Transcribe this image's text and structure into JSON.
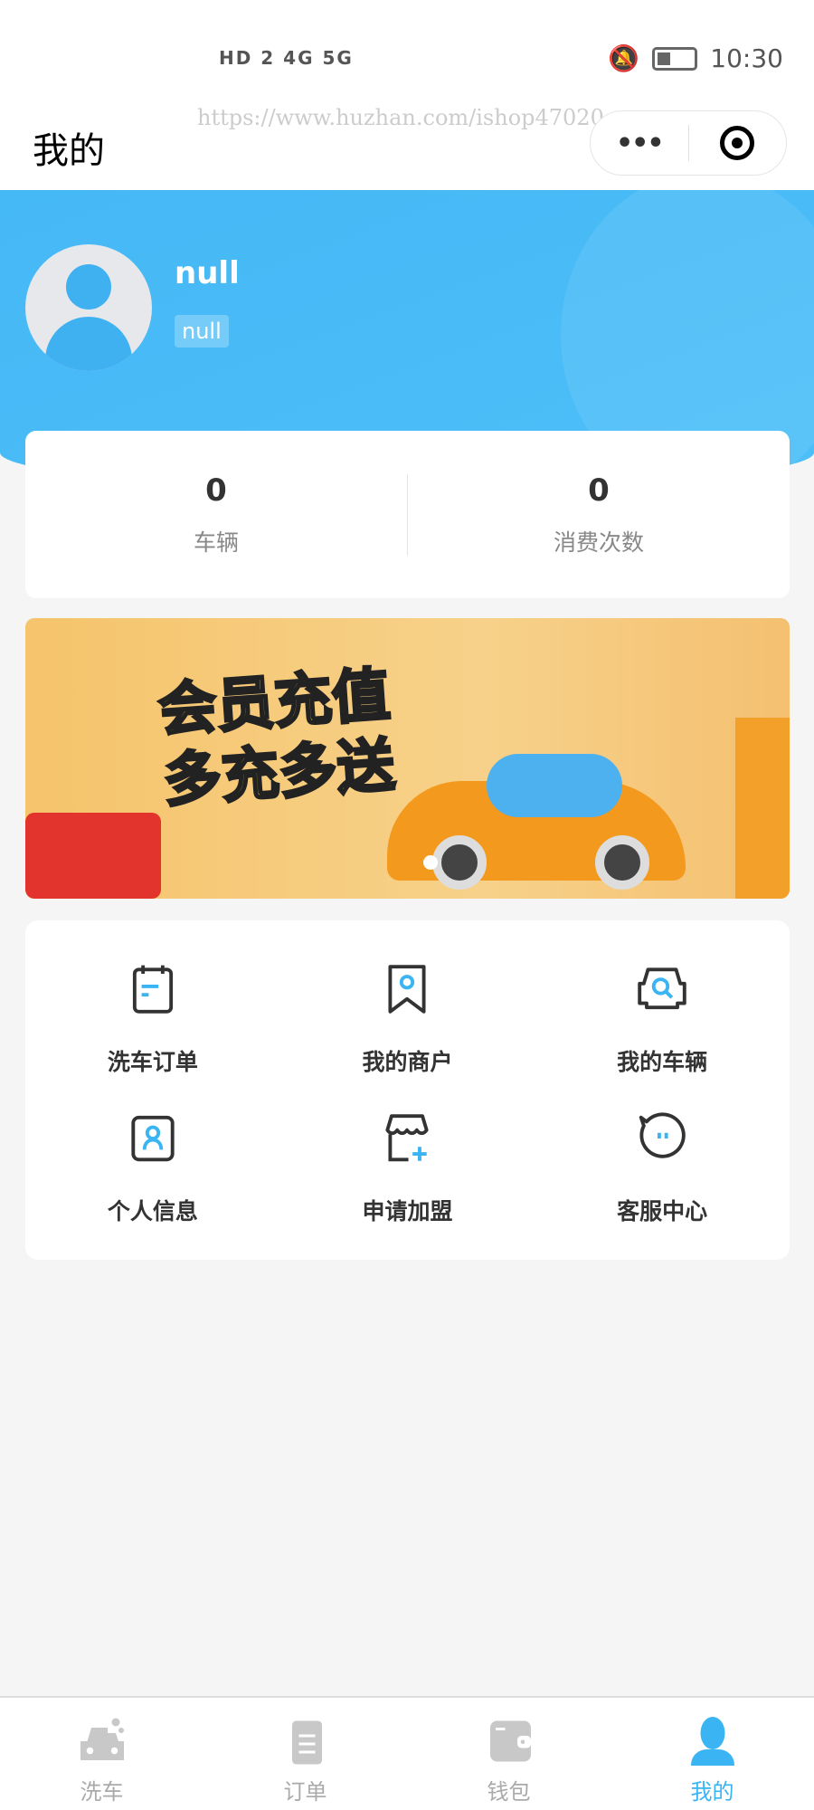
{
  "status_bar": {
    "left_icons": "HD 2 4G 5G",
    "time": "10:30"
  },
  "nav": {
    "title": "我的",
    "watermark": "https://www.huzhan.com/ishop47020",
    "more_label": "•••"
  },
  "profile": {
    "name": "null",
    "badge": "null"
  },
  "stats": [
    {
      "value": "0",
      "label": "车辆"
    },
    {
      "value": "0",
      "label": "消费次数"
    }
  ],
  "banner": {
    "line1": "会员充值",
    "line2": "多充多送"
  },
  "menu": [
    {
      "label": "洗车订单",
      "icon": "calendar-icon"
    },
    {
      "label": "我的商户",
      "icon": "bookmark-icon"
    },
    {
      "label": "我的车辆",
      "icon": "car-search-icon"
    },
    {
      "label": "个人信息",
      "icon": "user-card-icon"
    },
    {
      "label": "申请加盟",
      "icon": "store-add-icon"
    },
    {
      "label": "客服中心",
      "icon": "chat-icon"
    }
  ],
  "tabs": [
    {
      "label": "洗车",
      "icon": "car-icon"
    },
    {
      "label": "订单",
      "icon": "clipboard-icon"
    },
    {
      "label": "钱包",
      "icon": "wallet-icon"
    },
    {
      "label": "我的",
      "icon": "user-icon",
      "active": true
    }
  ],
  "colors": {
    "accent": "#3ab4f2",
    "hero": "#45b8f6",
    "icon_inactive": "#c8c8c8"
  }
}
